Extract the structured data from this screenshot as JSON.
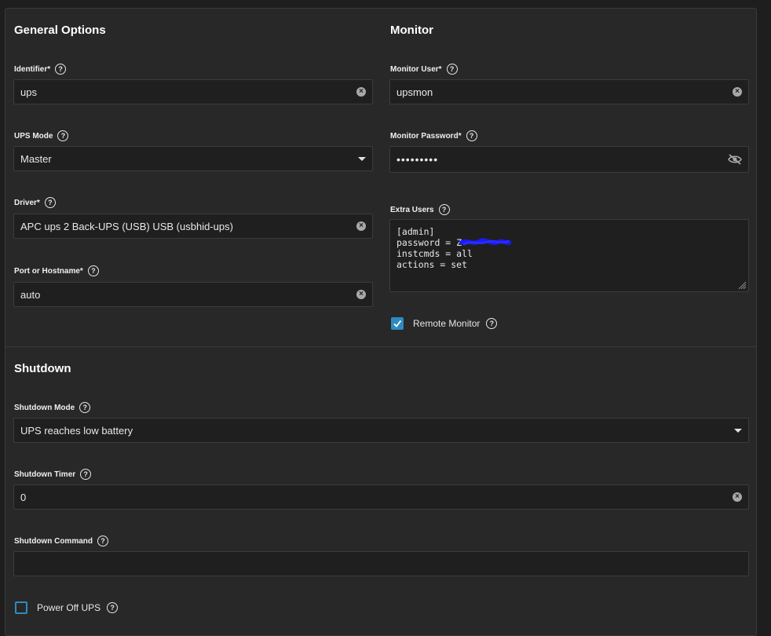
{
  "general": {
    "title": "General Options",
    "identifier": {
      "label": "Identifier",
      "required": "*",
      "value": "ups"
    },
    "ups_mode": {
      "label": "UPS Mode",
      "value": "Master"
    },
    "driver": {
      "label": "Driver",
      "required": "*",
      "value": "APC ups 2 Back-UPS (USB) USB (usbhid-ups)"
    },
    "port": {
      "label": "Port or Hostname",
      "required": "*",
      "value": "auto"
    }
  },
  "monitor": {
    "title": "Monitor",
    "user": {
      "label": "Monitor User",
      "required": "*",
      "value": "upsmon"
    },
    "password": {
      "label": "Monitor Password",
      "required": "*",
      "value": "•••••••••"
    },
    "extra_users": {
      "label": "Extra Users",
      "lines": [
        "[admin]",
        "password = Z",
        "instcmds = all",
        "actions = set"
      ]
    },
    "remote_monitor": {
      "label": "Remote Monitor",
      "checked": true
    }
  },
  "shutdown": {
    "title": "Shutdown",
    "mode": {
      "label": "Shutdown Mode",
      "value": "UPS reaches low battery"
    },
    "timer": {
      "label": "Shutdown Timer",
      "value": "0"
    },
    "command": {
      "label": "Shutdown Command",
      "value": ""
    },
    "power_off": {
      "label": "Power Off UPS",
      "checked": false
    }
  },
  "icons": {
    "help": "help-circle-icon",
    "clear": "clear-circle-icon",
    "dropdown": "caret-down-icon",
    "visibility": "eye-off-icon",
    "check": "check-icon"
  },
  "colors": {
    "background": "#1e1e1e",
    "card": "#282828",
    "input": "#1f1f1f",
    "accent": "#2f8ac2",
    "redaction": "#1a1aff"
  }
}
